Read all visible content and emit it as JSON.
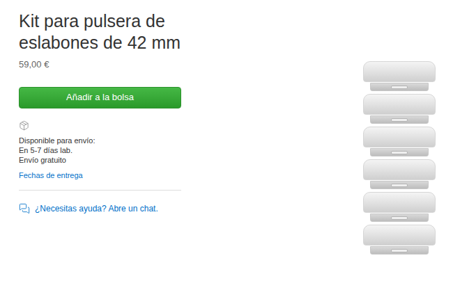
{
  "product": {
    "title": "Kit para pulsera de eslabones de 42 mm",
    "price": "59,00 €"
  },
  "add_button": {
    "label": "Añadir a la bolsa"
  },
  "shipping": {
    "heading": "Disponible para envío:",
    "lines": [
      "En 5-7 días lab.",
      "Envío gratuito"
    ],
    "link": "Fechas de entrega"
  },
  "help": {
    "text": "¿Necesitas ayuda? Abre un chat."
  }
}
